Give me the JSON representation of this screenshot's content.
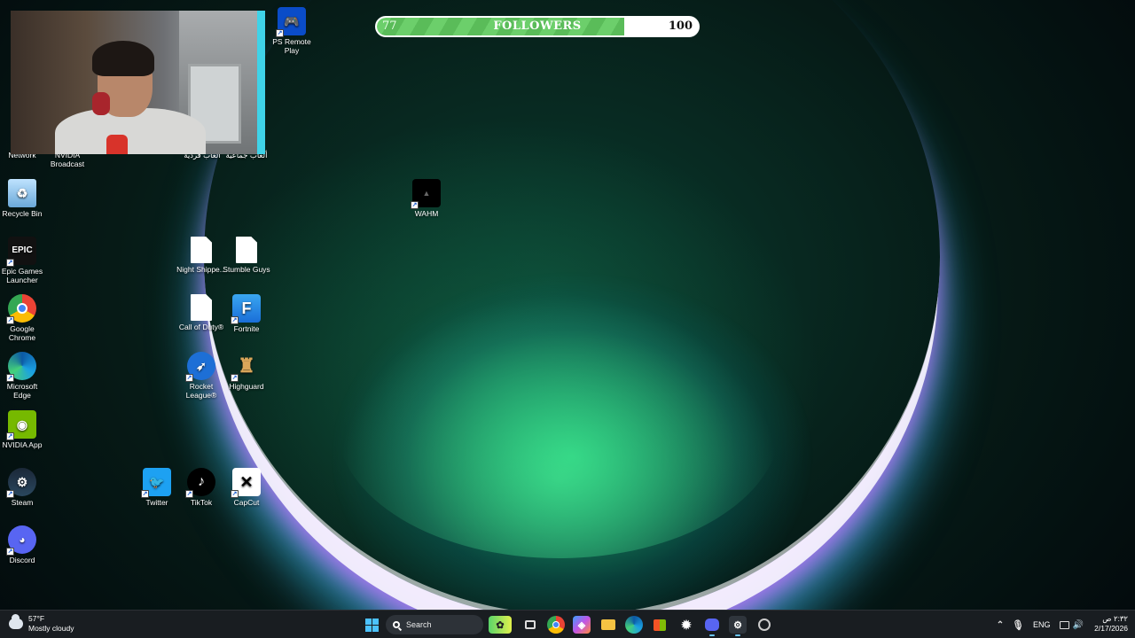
{
  "goal": {
    "label": "FOLLOWERS",
    "current": "77",
    "target": "100",
    "progress": 0.77
  },
  "desktop": {
    "partial_labels": {
      "arabic1": "ألعاب فردية",
      "arabic2": "ألعاب جماعية"
    },
    "icons": {
      "network": "Network",
      "nvidia_broadcast": "NVIDIA Broadcast",
      "ps_remote": "PS Remote Play",
      "recycle_bin": "Recycle Bin",
      "wahm": "WAHM",
      "epic": "Epic Games Launcher",
      "epic_logo": "EPIC",
      "night": "Night Shippe...",
      "stumble": "Stumble Guys",
      "chrome": "Google Chrome",
      "cod": "Call of Duty®",
      "fortnite": "Fortnite",
      "edge": "Microsoft Edge",
      "rocket": "Rocket League®",
      "highguard": "Highguard",
      "nvidia_app": "NVIDIA App",
      "steam": "Steam",
      "twitter": "Twitter",
      "tiktok": "TikTok",
      "capcut": "CapCut",
      "discord": "Discord"
    }
  },
  "taskbar": {
    "weather_temp": "57°F",
    "weather_desc": "Mostly cloudy",
    "search_label": "Search",
    "language": "ENG",
    "time": "٢:٣٢ ص",
    "date": "2/17/2026"
  },
  "colors": {
    "goal_fill": "#6ccf6b",
    "taskbar": "#1a1e22",
    "accent": "#4cc2ff"
  }
}
